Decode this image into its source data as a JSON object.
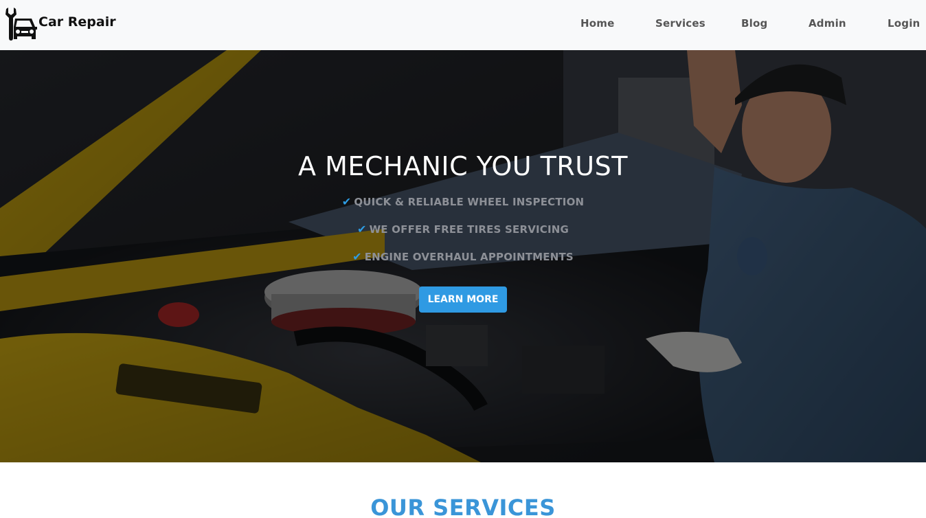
{
  "navbar": {
    "brand": "Car Repair",
    "links": [
      "Home",
      "Services",
      "Blog",
      "Admin",
      "Login"
    ]
  },
  "hero": {
    "title": "A MECHANIC YOU TRUST",
    "features": [
      "QUICK & RELIABLE WHEEL INSPECTION",
      "WE OFFER FREE TIRES SERVICING",
      "ENGINE OVERHAUL APPOINTMENTS"
    ],
    "cta": "LEARN MORE"
  },
  "services": {
    "title": "OUR SERVICES"
  },
  "icons": {
    "logo": "car-wrench-icon",
    "feature_bullet": "check-icon"
  },
  "colors": {
    "accent": "#2f9ae3",
    "navbar_bg": "#f8f9fa",
    "services_title": "#3a95d8"
  }
}
